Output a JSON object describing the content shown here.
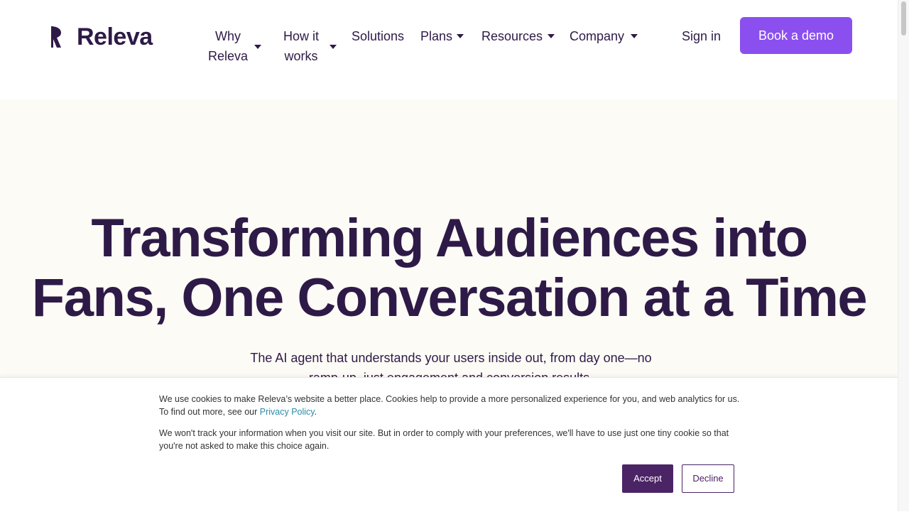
{
  "brand": {
    "name": "Releva",
    "color": "#2e1a47",
    "accent": "#8b4ff0"
  },
  "nav": {
    "items": [
      {
        "label_line1": "Why",
        "label_line2": "Releva",
        "has_dropdown": true
      },
      {
        "label_line1": "How it",
        "label_line2": "works",
        "has_dropdown": true
      },
      {
        "label": "Solutions",
        "has_dropdown": false
      },
      {
        "label": "Plans",
        "has_dropdown": true
      },
      {
        "label": "Resources",
        "has_dropdown": true
      },
      {
        "label": "Company",
        "has_dropdown": true
      }
    ],
    "sign_in": "Sign in",
    "cta": "Book a demo"
  },
  "hero": {
    "title_line1": "Transforming Audiences into",
    "title_line2": "Fans, One Conversation at a Time",
    "subtitle_line1": "The AI agent that understands your users inside out, from day one—no",
    "subtitle_line2": "ramp-up, just engagement and conversion results."
  },
  "cookie_banner": {
    "text1_before": "We use cookies to make Releva’s website a better place. Cookies help to provide a more personalized experience for you, and web analytics for us. To find out more, see our ",
    "privacy_link": "Privacy Policy",
    "text1_after": ".",
    "text2": "We won't track your information when you visit our site. But in order to comply with your preferences, we'll have to use just one tiny cookie so that you're not asked to make this choice again.",
    "accept": "Accept",
    "decline": "Decline",
    "accept_color": "#4b2466"
  }
}
